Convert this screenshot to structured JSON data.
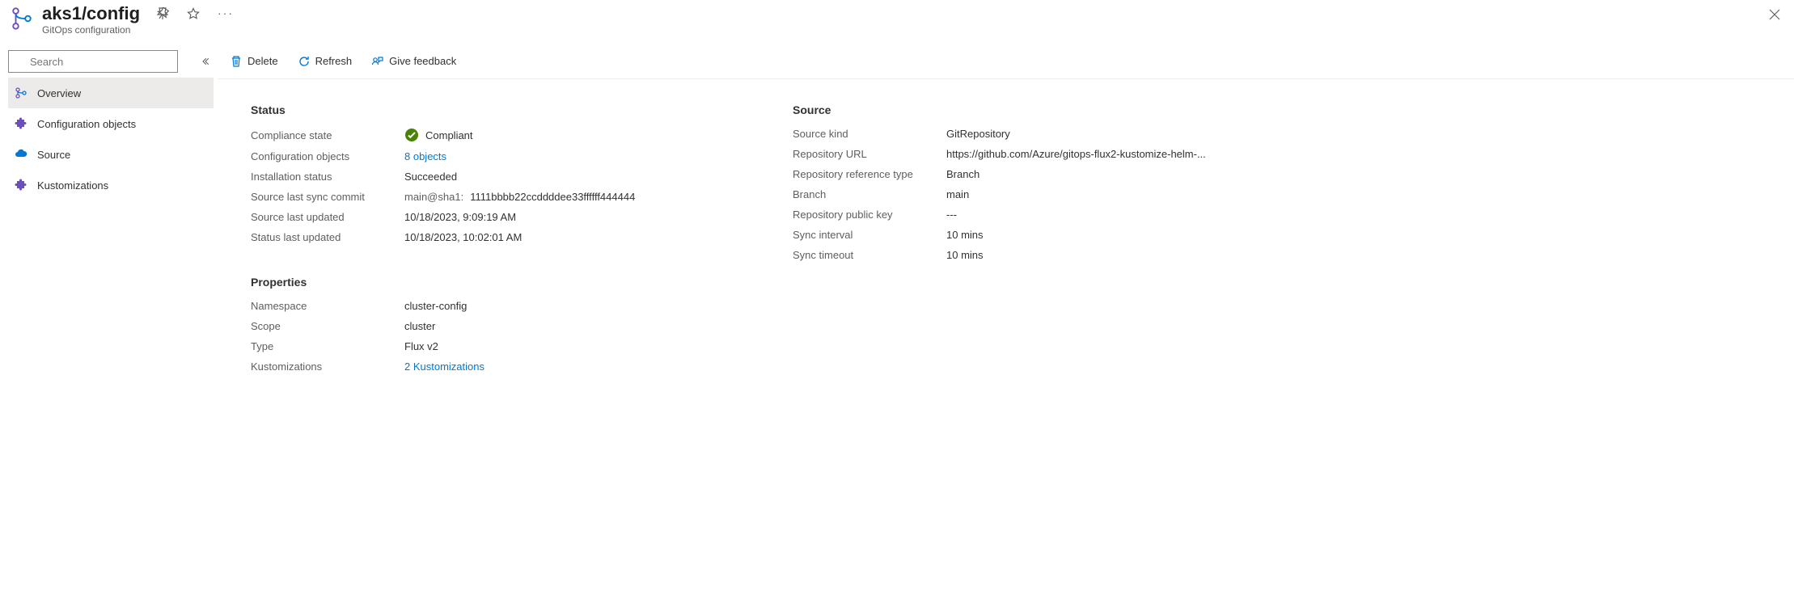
{
  "header": {
    "title": "aks1/config",
    "subtitle": "GitOps configuration"
  },
  "search": {
    "placeholder": "Search"
  },
  "nav": {
    "overview": "Overview",
    "config_objects": "Configuration objects",
    "source": "Source",
    "kustomizations": "Kustomizations"
  },
  "toolbar": {
    "delete": "Delete",
    "refresh": "Refresh",
    "feedback": "Give feedback"
  },
  "sections": {
    "status": "Status",
    "properties": "Properties",
    "source": "Source"
  },
  "status": {
    "compliance_state_label": "Compliance state",
    "compliance_state_value": "Compliant",
    "config_objects_label": "Configuration objects",
    "config_objects_value": "8 objects",
    "install_status_label": "Installation status",
    "install_status_value": "Succeeded",
    "source_last_sync_commit_label": "Source last sync commit",
    "source_last_sync_commit_prefix": "main@sha1:",
    "source_last_sync_commit_hash": "1111bbbb22ccddddee33ffffff444444",
    "source_last_updated_label": "Source last updated",
    "source_last_updated_value": "10/18/2023, 9:09:19 AM",
    "status_last_updated_label": "Status last updated",
    "status_last_updated_value": "10/18/2023, 10:02:01 AM"
  },
  "properties": {
    "namespace_label": "Namespace",
    "namespace_value": "cluster-config",
    "scope_label": "Scope",
    "scope_value": "cluster",
    "type_label": "Type",
    "type_value": "Flux v2",
    "kustomizations_label": "Kustomizations",
    "kustomizations_value": "2 Kustomizations"
  },
  "source": {
    "kind_label": "Source kind",
    "kind_value": "GitRepository",
    "repo_url_label": "Repository URL",
    "repo_url_value": "https://github.com/Azure/gitops-flux2-kustomize-helm-...",
    "ref_type_label": "Repository reference type",
    "ref_type_value": "Branch",
    "branch_label": "Branch",
    "branch_value": "main",
    "pubkey_label": "Repository public key",
    "pubkey_value": "---",
    "sync_interval_label": "Sync interval",
    "sync_interval_value": "10 mins",
    "sync_timeout_label": "Sync timeout",
    "sync_timeout_value": "10 mins"
  }
}
